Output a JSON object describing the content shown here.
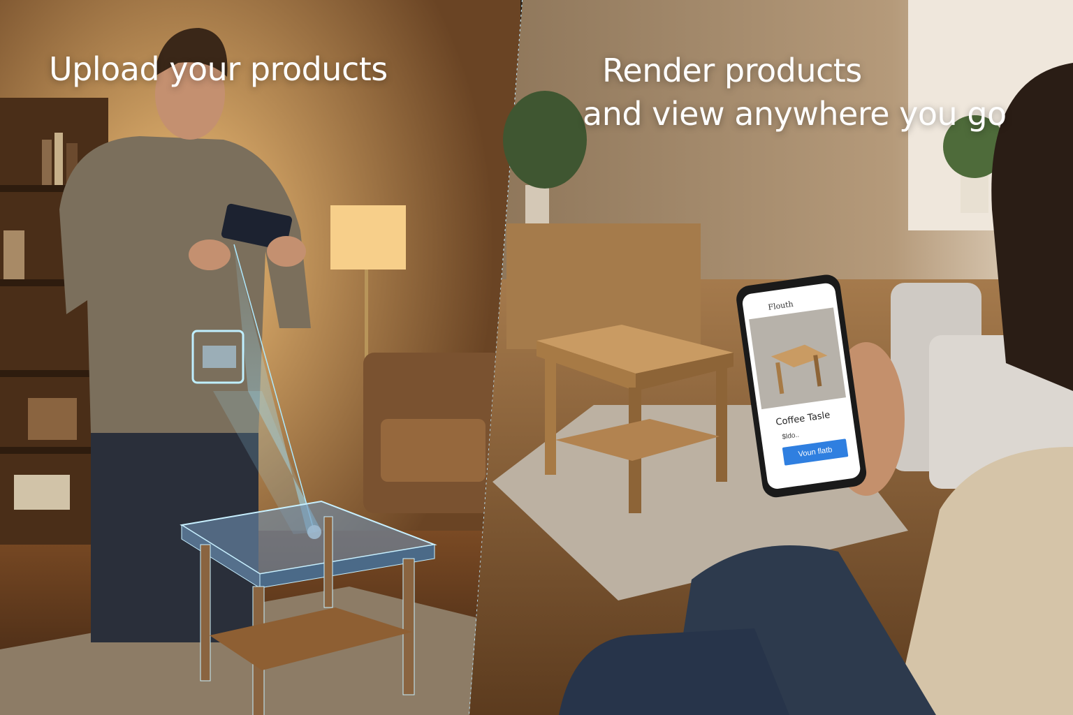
{
  "left_panel": {
    "caption": "Upload your products"
  },
  "right_panel": {
    "caption_line1": "Render products",
    "caption_line2": "and view anywhere you go"
  },
  "phone_screen": {
    "app_title": "Flouth",
    "product_name": "Coffee Tasle",
    "product_price": "$ldo..",
    "action_button": "Voun flatb"
  },
  "colors": {
    "warm_wall": "#b98a55",
    "scan_beam": "#7fd6ff",
    "button_blue": "#2f7fe0"
  }
}
